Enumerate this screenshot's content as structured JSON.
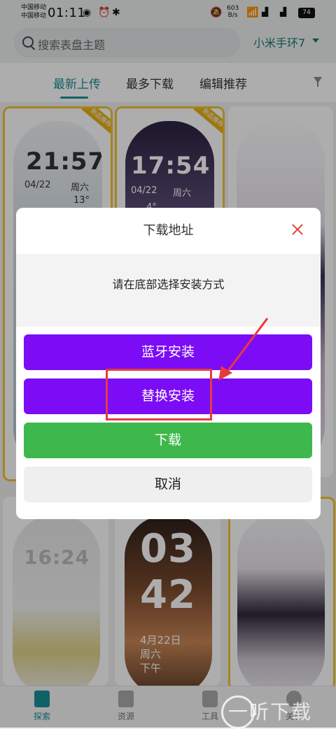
{
  "status_bar": {
    "carrier_1": "中国移动",
    "carrier_2": "中国移动",
    "time": "01:11",
    "net_speed_value": "603",
    "net_speed_unit": "B/s",
    "battery": "74"
  },
  "header": {
    "search_placeholder": "搜索表盘主题",
    "device": "小米手环7"
  },
  "tabs": [
    {
      "label": "最新上传",
      "active": true
    },
    {
      "label": "最多下载",
      "active": false
    },
    {
      "label": "编辑推荐",
      "active": false
    }
  ],
  "watchfaces": {
    "card1": {
      "time": "21:57",
      "date": "04/22",
      "weekday": "周六",
      "temp": "13°",
      "badge": "新品推荐"
    },
    "card2": {
      "time": "17:54",
      "date": "04/22",
      "weekday": "周六",
      "temp": "4°",
      "badge": "新品推荐"
    },
    "card5": {
      "time": "16:24"
    },
    "card6": {
      "hour": "03",
      "minute": "42",
      "date": "4月22日",
      "weekday": "周六",
      "period": "下午"
    }
  },
  "dialog": {
    "title": "下载地址",
    "message": "请在底部选择安装方式",
    "buttons": {
      "bluetooth": "蓝牙安装",
      "replace": "替换安装",
      "download": "下载",
      "cancel": "取消"
    }
  },
  "bottom_nav": [
    {
      "label": "探索",
      "active": true
    },
    {
      "label": "资源",
      "active": false
    },
    {
      "label": "工具",
      "active": false
    },
    {
      "label": "关于",
      "active": false
    }
  ],
  "watermark": "一听下载",
  "colors": {
    "accent": "#1a8f9a",
    "purple_button": "#7b0cf5",
    "green_button": "#3eb84c",
    "highlight_red": "#e8393f",
    "badge_gold": "#f0c531"
  }
}
